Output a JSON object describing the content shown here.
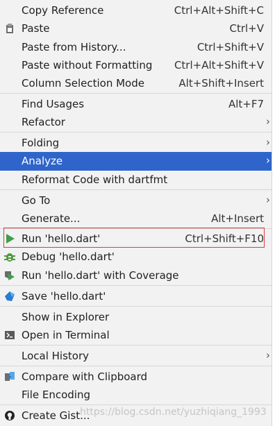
{
  "menu": {
    "items": [
      {
        "label": "Copy Reference",
        "shortcut": "Ctrl+Alt+Shift+C",
        "icon": "none"
      },
      {
        "label": "Paste",
        "shortcut": "Ctrl+V",
        "icon": "clipboard-icon"
      },
      {
        "label": "Paste from History...",
        "shortcut": "Ctrl+Shift+V",
        "icon": "none"
      },
      {
        "label": "Paste without Formatting",
        "shortcut": "Ctrl+Alt+Shift+V",
        "icon": "none"
      },
      {
        "label": "Column Selection Mode",
        "shortcut": "Alt+Shift+Insert",
        "icon": "none"
      },
      {
        "label": "Find Usages",
        "shortcut": "Alt+F7",
        "icon": "none"
      },
      {
        "label": "Refactor",
        "shortcut": "",
        "icon": "none",
        "submenu": true
      },
      {
        "label": "Folding",
        "shortcut": "",
        "icon": "none",
        "submenu": true
      },
      {
        "label": "Analyze",
        "shortcut": "",
        "icon": "none",
        "submenu": true,
        "selected": true
      },
      {
        "label": "Reformat Code with dartfmt",
        "shortcut": "",
        "icon": "none"
      },
      {
        "label": "Go To",
        "shortcut": "",
        "icon": "none",
        "submenu": true
      },
      {
        "label": "Generate...",
        "shortcut": "Alt+Insert",
        "icon": "none"
      },
      {
        "label": "Run 'hello.dart'",
        "shortcut": "Ctrl+Shift+F10",
        "icon": "run-icon"
      },
      {
        "label": "Debug 'hello.dart'",
        "shortcut": "",
        "icon": "debug-icon"
      },
      {
        "label": "Run 'hello.dart' with Coverage",
        "shortcut": "",
        "icon": "coverage-icon"
      },
      {
        "label": "Save 'hello.dart'",
        "shortcut": "",
        "icon": "dart-icon"
      },
      {
        "label": "Show in Explorer",
        "shortcut": "",
        "icon": "none"
      },
      {
        "label": "Open in Terminal",
        "shortcut": "",
        "icon": "terminal-icon"
      },
      {
        "label": "Local History",
        "shortcut": "",
        "icon": "none",
        "submenu": true
      },
      {
        "label": "Compare with Clipboard",
        "shortcut": "",
        "icon": "compare-icon"
      },
      {
        "label": "File Encoding",
        "shortcut": "",
        "icon": "none"
      },
      {
        "label": "Create Gist...",
        "shortcut": "",
        "icon": "github-icon"
      }
    ],
    "submenu_arrow": "›"
  },
  "watermark": "https://blog.csdn.net/yuzhiqiang_1993",
  "colors": {
    "background": "#f2f2f2",
    "selected": "#2f65ca",
    "highlight_border": "#e0393e"
  }
}
